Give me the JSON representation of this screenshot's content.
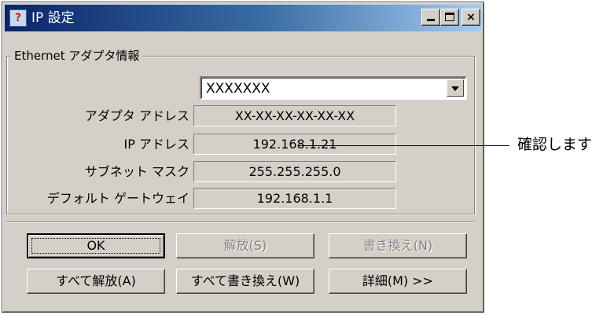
{
  "window": {
    "title": "IP 設定",
    "title_icon": "help-question-icon",
    "controls": {
      "minimize": "minimize-icon",
      "maximize": "maximize-icon",
      "close": "×"
    }
  },
  "adapter_group": {
    "label": "Ethernet  アダプタ情報",
    "selected_adapter": "XXXXXXX",
    "rows": [
      {
        "label": "アダプタ アドレス",
        "value": "XX-XX-XX-XX-XX-XX"
      },
      {
        "label": "IP アドレス",
        "value": "192.168.1.21"
      },
      {
        "label": "サブネット マスク",
        "value": "255.255.255.0"
      },
      {
        "label": "デフォルト ゲートウェイ",
        "value": "192.168.1.1"
      }
    ]
  },
  "callout": {
    "text": "確認します"
  },
  "buttons": {
    "ok": "OK",
    "release": "解放(S)",
    "renew": "書き換え(N)",
    "release_all": "すべて解放(A)",
    "renew_all": "すべて書き換え(W)",
    "details": "詳細(M) >>"
  },
  "colors": {
    "face": "#d4d0c8",
    "title_start": "#0a246a",
    "title_end": "#a6caf0",
    "disabled_text": "#808080"
  }
}
